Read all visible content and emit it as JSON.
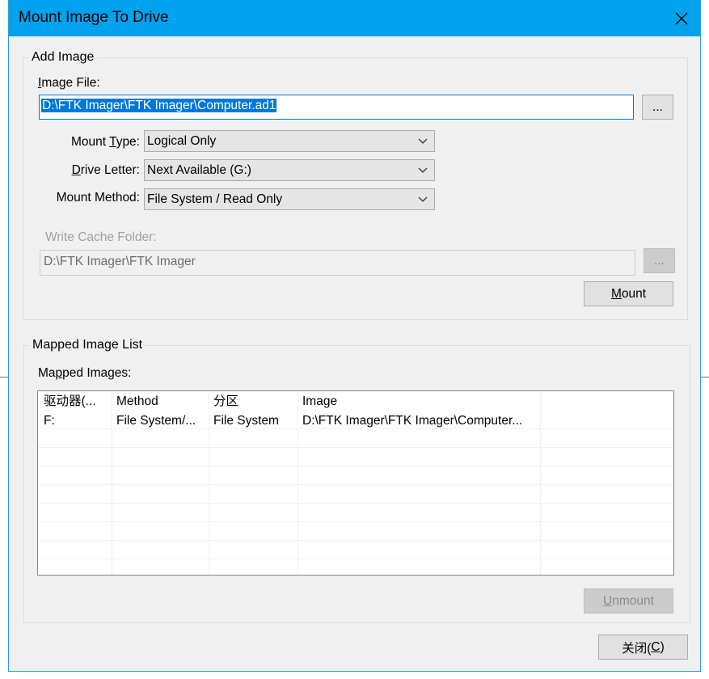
{
  "window": {
    "title": "Mount Image To Drive"
  },
  "add_image": {
    "group_label": "Add Image",
    "image_file_label": "Image File:",
    "image_file_mnemonic": "I",
    "image_file_rest": "mage File:",
    "image_file_value": "D:\\FTK Imager\\FTK Imager\\Computer.ad1",
    "browse_label": "...",
    "mount_type": {
      "label_pre": "Mount ",
      "mnemonic": "T",
      "label_post": "ype:",
      "value": "Logical Only"
    },
    "drive_letter": {
      "mnemonic": "D",
      "label_post": "rive Letter:",
      "value": "Next Available (G:)"
    },
    "mount_method": {
      "label": "Mount Method:",
      "value": "File System / Read Only"
    },
    "write_cache_label": "Write Cache Folder:",
    "write_cache_value": "D:\\FTK Imager\\FTK Imager",
    "cache_browse_label": "...",
    "mount_button": {
      "mnemonic": "M",
      "rest": "ount"
    }
  },
  "mapped": {
    "group_label": "Mapped Image List",
    "list_label_pre": "Ma",
    "list_label_mnemonic": "p",
    "list_label_post": "ped Images:",
    "columns": [
      "驱动器(...",
      "Method",
      "分区",
      "Image"
    ],
    "rows": [
      [
        "F:",
        "File System/...",
        "File System",
        "D:\\FTK Imager\\FTK Imager\\Computer..."
      ]
    ],
    "unmount_button": {
      "mnemonic": "U",
      "rest": "nmount"
    }
  },
  "close_button": {
    "pre": "关闭(",
    "mnemonic": "C",
    "post": ")"
  }
}
